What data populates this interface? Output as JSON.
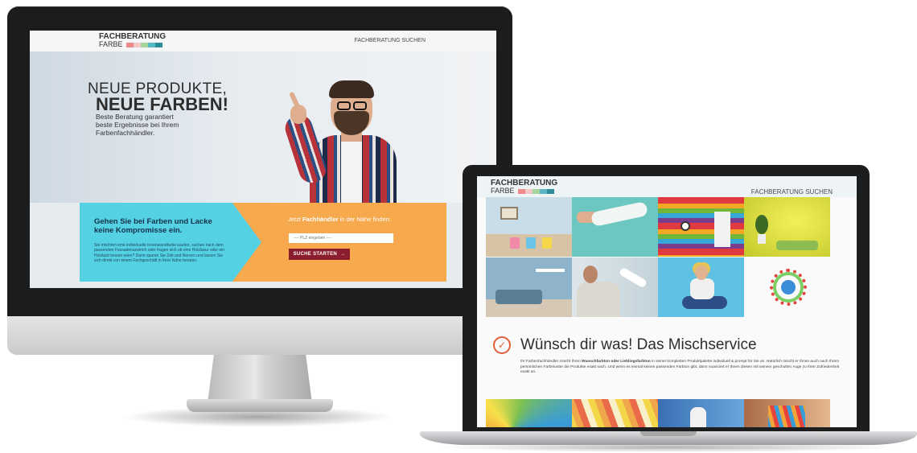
{
  "brand": {
    "line1": "FACHBERATUNG",
    "line2": "FARBE",
    "swatch_colors": [
      "#f08a8a",
      "#f3c7c7",
      "#a6d59a",
      "#5ab6c4",
      "#2e8c9a"
    ]
  },
  "desktop": {
    "nav": {
      "link": "FACHBERATUNG SUCHEN"
    },
    "hero": {
      "headline_line1": "NEUE PRODUKTE,",
      "headline_line2": "NEUE FARBEN!",
      "subtext": "Beste Beratung garantiert beste Ergebnisse bei Ihrem Farbenfachhändler."
    },
    "cta": {
      "title": "Gehen Sie bei Farben und Lacke keine Kompromisse ein.",
      "text": "Sie möchten eine individuelle Innenwandfarbe kaufen, suchen nach dem passenden Fassadenanstrich oder fragen sich ob eine Holzlasur oder ein Holzlack besser wäre? Dann sparen Sie Zeit und Nerven und lassen Sie sich direkt von einem Fachgeschäft in Ihrer Nähe beraten.",
      "question_prefix": "Jetzt ",
      "question_bold": "Fachhändler",
      "question_suffix": " in der Nähe finden:",
      "plz_placeholder": "---- PLZ eingeben ----",
      "button_label": "SUCHE STARTEN",
      "button_icon": "arrow-right-icon"
    },
    "colors": {
      "cta_left": "#55d1e4",
      "cta_right": "#f7a94e",
      "button": "#8b1c2e"
    }
  },
  "laptop": {
    "nav": {
      "link": "FACHBERATUNG SUCHEN"
    },
    "section": {
      "icon": "checkmark-circle-icon",
      "title": "Wünsch dir was! Das Mischservice",
      "text_part1": "Ihr Farbenfachhändler mischt Ihren ",
      "text_bold": "Wunschfarbton oder Lieblingsfarbton",
      "text_part2": " in seiner kompletten Produktpalette individuell & prompt für Sie an. Natürlich mischt er Ihnen auch nach Ihrem persönlichen Farbmuster die Produkte exakt nach. Und wenn es einmal keinen passenden Farbton gibt, dann nuanciert er Ihnen diesen mit seinem geschulten Auge zu Ihrer Zufriedenheit exakt an."
    }
  }
}
